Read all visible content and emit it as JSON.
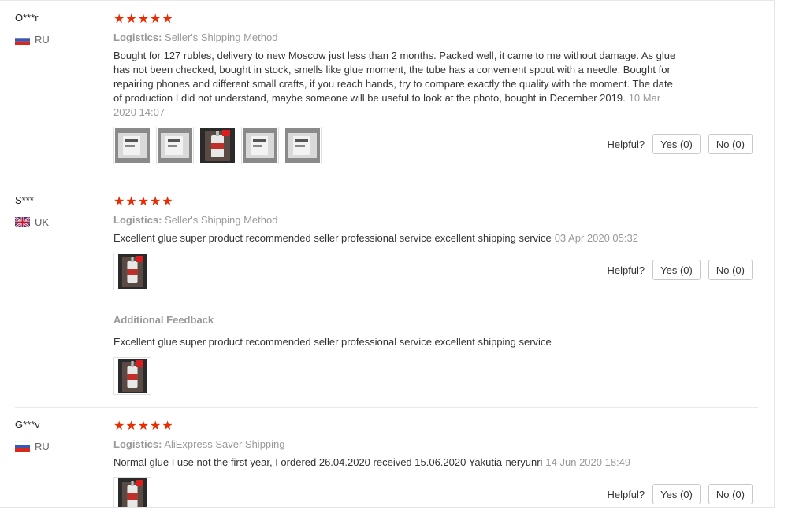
{
  "reviews": [
    {
      "user": "O***r",
      "country": "RU",
      "flag": "ru",
      "stars": "★★★★★",
      "rating": 5,
      "logistics_label": "Logistics:",
      "logistics_value": "Seller's Shipping Method",
      "text": "Bought for 127 rubles, delivery to new Moscow just less than 2 months. Packed well, it came to me without damage. As glue has not been checked, bought in stock, smells like glue moment, the tube has a convenient spout with a needle. Bought for repairing phones and different small crafts, if you reach hands, try to compare exactly the quality with the moment. The date of production I did not understand, maybe someone will be useful to look at the photo, bought in December 2019.",
      "date": "10 Mar 2020 14:07",
      "photo_count": 5,
      "helpful_label": "Helpful?",
      "yes_label": "Yes (0)",
      "no_label": "No (0)"
    },
    {
      "user": "S***",
      "country": "UK",
      "flag": "uk",
      "stars": "★★★★★",
      "rating": 5,
      "logistics_label": "Logistics:",
      "logistics_value": "Seller's Shipping Method",
      "text": "Excellent glue super product recommended seller professional service excellent shipping service",
      "date": "03 Apr 2020 05:32",
      "photo_count": 1,
      "helpful_label": "Helpful?",
      "yes_label": "Yes (0)",
      "no_label": "No (0)",
      "additional": {
        "title": "Additional Feedback",
        "text": "Excellent glue super product recommended seller professional service excellent shipping service",
        "photo_count": 1
      }
    },
    {
      "user": "G***v",
      "country": "RU",
      "flag": "ru",
      "stars": "★★★★★",
      "rating": 5,
      "logistics_label": "Logistics:",
      "logistics_value": "AliExpress Saver Shipping",
      "text": "Normal glue I use not the first year, I ordered 26.04.2020 received 15.06.2020 Yakutia-neryunri",
      "date": "14 Jun 2020 18:49",
      "photo_count": 1,
      "helpful_label": "Helpful?",
      "yes_label": "Yes (0)",
      "no_label": "No (0)"
    }
  ],
  "colors": {
    "star": "#e62e04",
    "muted": "#999999",
    "divider": "#eaeaea"
  }
}
